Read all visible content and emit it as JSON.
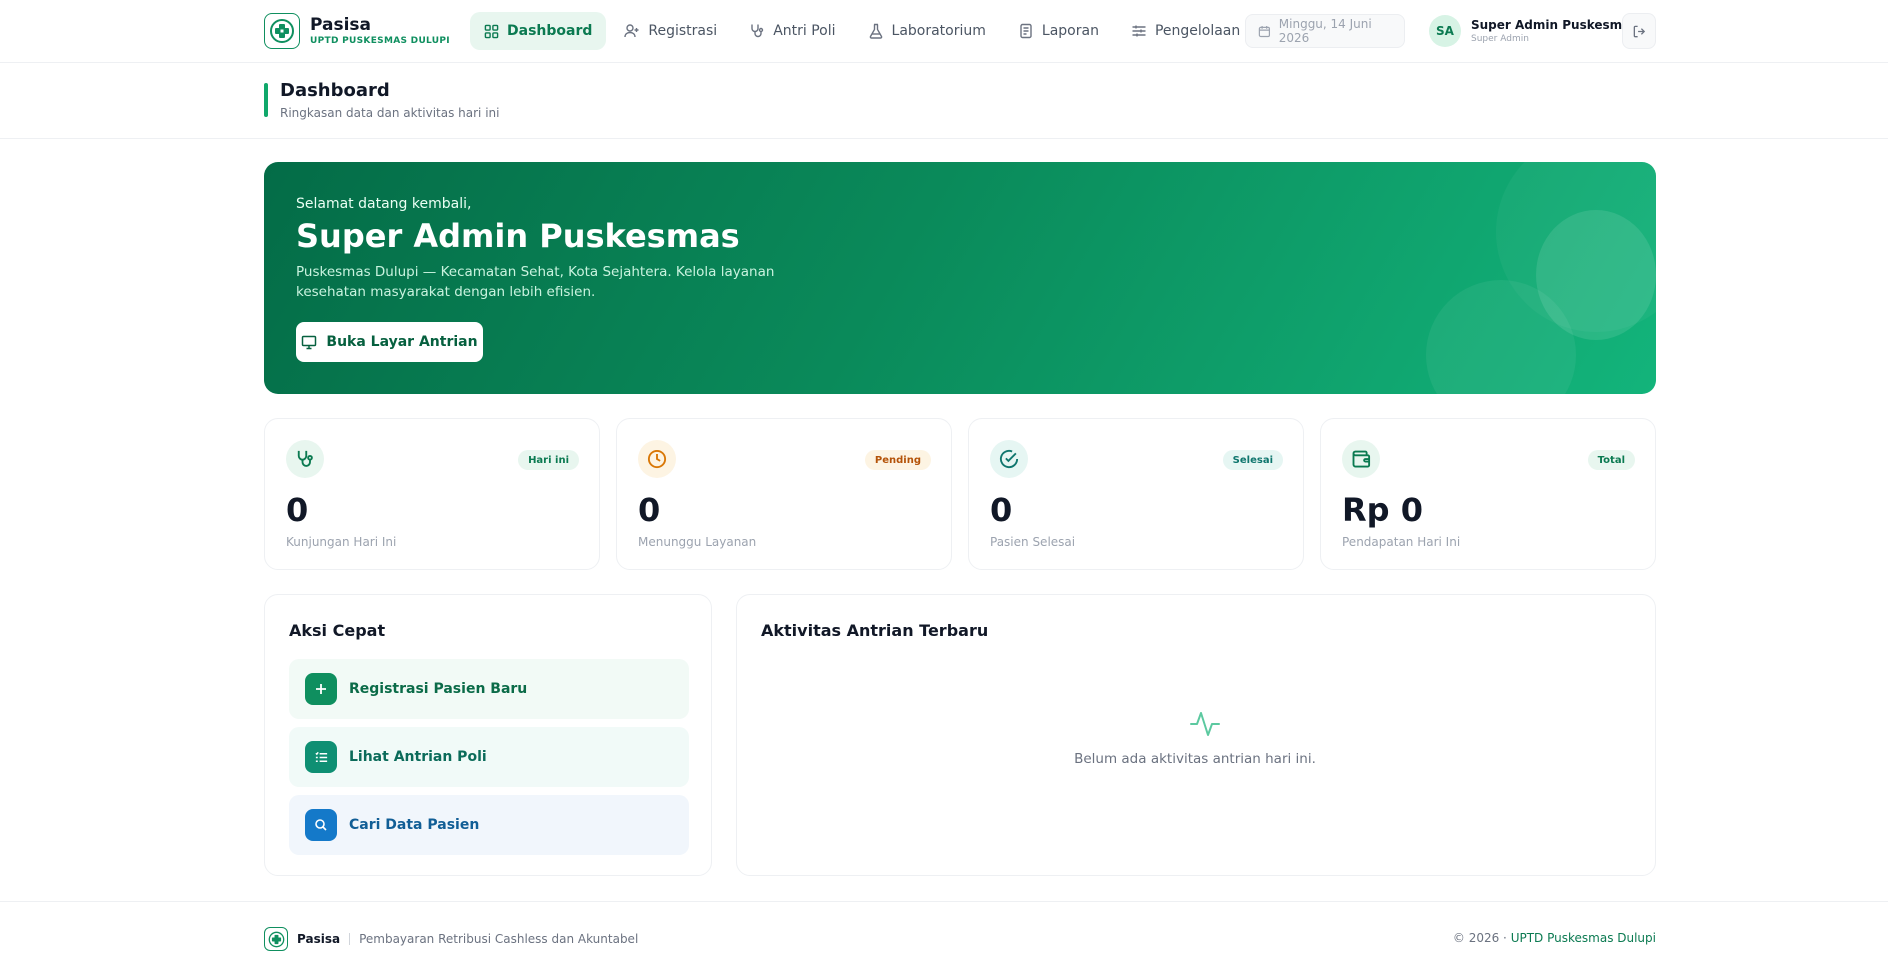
{
  "brand": {
    "name": "Pasisa",
    "subtitle": "UPTD PUSKESMAS DULUPI"
  },
  "nav": {
    "items": [
      {
        "label": "Dashboard",
        "icon": "grid-icon",
        "active": true
      },
      {
        "label": "Registrasi",
        "icon": "user-plus-icon"
      },
      {
        "label": "Antri Poli",
        "icon": "stethoscope-icon"
      },
      {
        "label": "Laboratorium",
        "icon": "flask-icon"
      },
      {
        "label": "Laporan",
        "icon": "document-icon"
      },
      {
        "label": "Pengelolaan",
        "icon": "sliders-icon",
        "dropdown": true
      }
    ]
  },
  "header_right": {
    "date": "Minggu, 14 Juni 2026",
    "user_initials": "SA",
    "user_name": "Super Admin Puskesmas",
    "user_role": "Super Admin"
  },
  "page": {
    "title": "Dashboard",
    "subtitle": "Ringkasan data dan aktivitas hari ini"
  },
  "hero": {
    "greeting": "Selamat datang kembali,",
    "name": "Super Admin Puskesmas",
    "description": "Puskesmas Dulupi — Kecamatan Sehat, Kota Sejahtera. Kelola layanan kesehatan masyarakat dengan lebih efisien.",
    "button_label": "Buka Layar Antrian"
  },
  "stats": [
    {
      "badge": "Hari ini",
      "value": "0",
      "label": "Kunjungan Hari Ini",
      "icon": "stethoscope-icon",
      "color": "#0b7a51",
      "bg": "#e8f6ef"
    },
    {
      "badge": "Pending",
      "value": "0",
      "label": "Menunggu Layanan",
      "icon": "clock-icon",
      "color": "#b45309",
      "bg": "#fdf4e3"
    },
    {
      "badge": "Selesai",
      "value": "0",
      "label": "Pasien Selesai",
      "icon": "check-circle-icon",
      "color": "#0f766e",
      "bg": "#e6f6f3"
    },
    {
      "badge": "Total",
      "value": "Rp 0",
      "label": "Pendapatan Hari Ini",
      "icon": "wallet-icon",
      "color": "#0b7a51",
      "bg": "#e8f6ef"
    }
  ],
  "quick_actions": {
    "title": "Aksi Cepat",
    "items": [
      {
        "label": "Registrasi Pasien Baru",
        "icon": "plus-icon"
      },
      {
        "label": "Lihat Antrian Poli",
        "icon": "list-icon"
      },
      {
        "label": "Cari Data Pasien",
        "icon": "search-icon"
      }
    ]
  },
  "activity": {
    "title": "Aktivitas Antrian Terbaru",
    "empty_text": "Belum ada aktivitas antrian hari ini.",
    "empty_icon": "activity-icon"
  },
  "footer": {
    "brand": "Pasisa",
    "tagline": "Pembayaran Retribusi Cashless dan Akuntabel",
    "copyright": "© 2026 ·",
    "org": "UPTD Puskesmas Dulupi"
  },
  "colors": {
    "primary": "#0b7a51",
    "accent": "#10a86b",
    "hero_start": "#046c47",
    "hero_end": "#13b47b"
  }
}
